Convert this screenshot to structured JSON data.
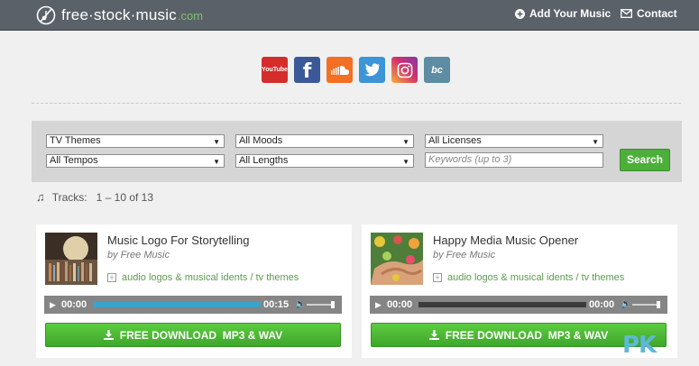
{
  "site": {
    "logo_text": "free·stock·music",
    "logo_suffix": ".com"
  },
  "nav": {
    "add_music": "Add Your Music",
    "contact": "Contact"
  },
  "social": [
    {
      "name": "youtube",
      "label": "YouTube",
      "color": "#d52c2c"
    },
    {
      "name": "facebook",
      "label": "f",
      "color": "#3b5998"
    },
    {
      "name": "soundcloud",
      "label": "",
      "color": "#f26f23"
    },
    {
      "name": "twitter",
      "label": "",
      "color": "#3d94d7"
    },
    {
      "name": "instagram",
      "label": "",
      "color": "#d2306b"
    },
    {
      "name": "bandcamp",
      "label": "bc",
      "color": "#5d8ca3"
    }
  ],
  "filters": {
    "themes": "TV Themes",
    "moods": "All Moods",
    "licenses": "All Licenses",
    "tempos": "All Tempos",
    "lengths": "All Lengths",
    "keywords_placeholder": "Keywords (up to 3)",
    "search_label": "Search"
  },
  "tracks_summary": {
    "label": "Tracks:",
    "range": "1 – 10 of 13"
  },
  "tracks": [
    {
      "title": "Music Logo For Storytelling",
      "by": "by Free Music",
      "tags": "audio logos & musical idents / tv themes",
      "current_time": "00:00",
      "duration": "00:15",
      "progress": 1.0,
      "download": "FREE DOWNLOAD  MP3 & WAV"
    },
    {
      "title": "Happy Media Music Opener",
      "by": "by Free Music",
      "tags": "audio logos & musical idents / tv themes",
      "current_time": "00:00",
      "duration": "00:00",
      "progress": 0.0,
      "download": "FREE DOWNLOAD  MP3 & WAV"
    }
  ],
  "watermark": "PK",
  "colors": {
    "header": "#5b6169",
    "accent_green": "#4caf3a",
    "tag_green": "#5e9a4d",
    "progress_blue": "#3aa3c9"
  }
}
